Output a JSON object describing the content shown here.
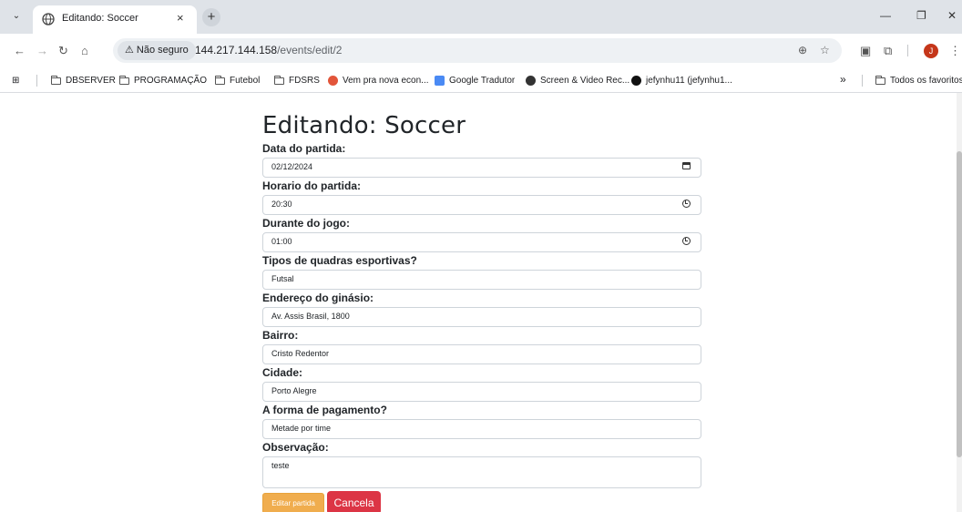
{
  "browser": {
    "tab_title": "Editando: Soccer",
    "new_tab_label": "+",
    "security_label": "⚠ Não seguro",
    "url_host": "144.217.144.158",
    "url_path": "/events/edit/2",
    "profile_initial": "J"
  },
  "bookmarks": [
    {
      "label": "DBSERVER",
      "icon": "folder-icon"
    },
    {
      "label": "PROGRAMAÇÃO",
      "icon": "folder-icon"
    },
    {
      "label": "Futebol",
      "icon": "folder-icon"
    },
    {
      "label": "FDSRS",
      "icon": "folder-icon"
    },
    {
      "label": "Vem pra nova econ...",
      "icon": "site-icon"
    },
    {
      "label": "Google Tradutor",
      "icon": "translate-icon"
    },
    {
      "label": "Screen & Video Rec...",
      "icon": "record-icon"
    },
    {
      "label": "jefynhu11 (jefynhu1...",
      "icon": "github-icon"
    }
  ],
  "bookmarks_more": "»",
  "all_bookmarks_label": "Todos os favoritos",
  "page": {
    "title": "Editando: Soccer",
    "fields": {
      "date": {
        "label": "Data do partida:",
        "value": "02/12/2024"
      },
      "time": {
        "label": "Horario do partida:",
        "value": "20:30"
      },
      "duration": {
        "label": "Durante do jogo:",
        "value": "01:00"
      },
      "court_type": {
        "label": "Tipos de quadras esportivas?",
        "value": "Futsal"
      },
      "address": {
        "label": "Endereço do ginásio:",
        "value": "Av. Assis Brasil, 1800"
      },
      "district": {
        "label": "Bairro:",
        "value": "Cristo Redentor"
      },
      "city": {
        "label": "Cidade:",
        "value": "Porto Alegre"
      },
      "payment": {
        "label": "A forma de pagamento?",
        "value": "Metade por time"
      },
      "notes": {
        "label": "Observação:",
        "value": "teste"
      }
    },
    "submit_label": "Editar partida",
    "cancel_label": "Cancela"
  },
  "colors": {
    "warning": "#f0ad4e",
    "danger": "#dc3545"
  }
}
